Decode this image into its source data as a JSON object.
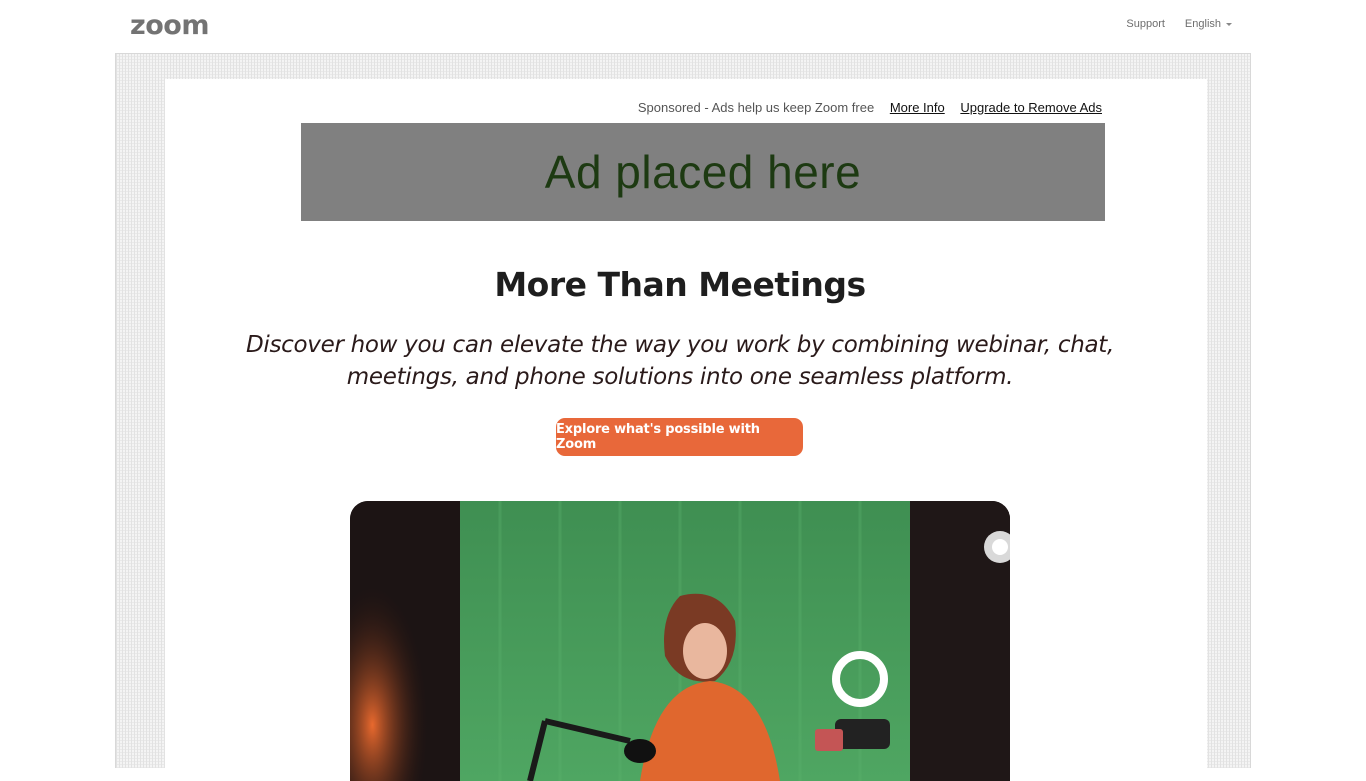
{
  "header": {
    "logo_text": "zoom",
    "nav": {
      "support_label": "Support",
      "language_label": "English"
    }
  },
  "ad": {
    "sponsored_text": "Sponsored - Ads help us keep Zoom free",
    "more_info_label": "More Info",
    "upgrade_label": "Upgrade to Remove Ads",
    "placeholder_text": "Ad placed here",
    "background_color": "#808080"
  },
  "main": {
    "headline": "More Than Meetings",
    "subheadline": "Discover how you can elevate the way you work by combining webinar, chat, meetings, and phone solutions into one seamless platform.",
    "cta_label": "Explore what's possible with Zoom",
    "cta_color": "#e8683a"
  },
  "hero_image": {
    "description_icon": "woman-green-screen-photo"
  }
}
